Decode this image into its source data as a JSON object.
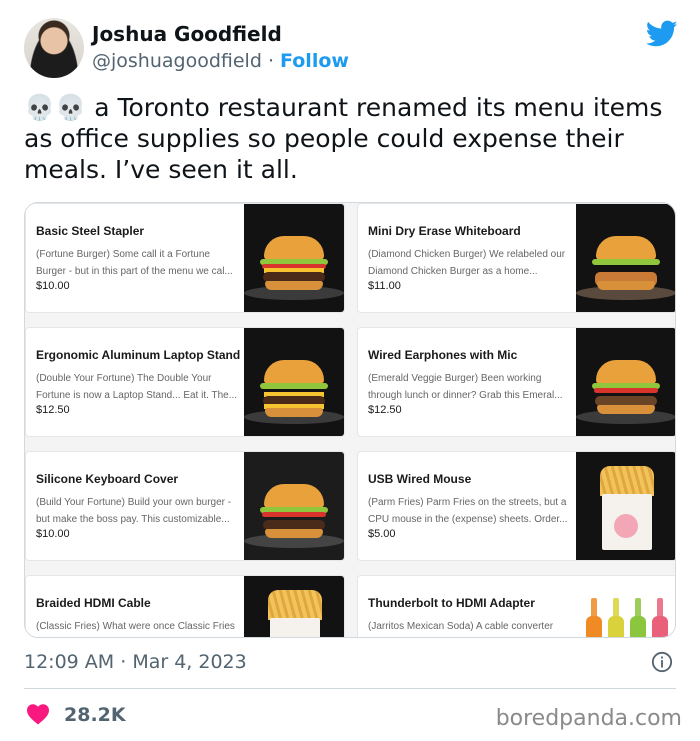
{
  "author": {
    "name": "Joshua Goodfield",
    "handle": "@joshuagoodfield",
    "separator": "·",
    "follow_label": "Follow"
  },
  "tweet": {
    "text": "💀💀 a Toronto restaurant renamed its menu items as office supplies so people could expense their meals. I’ve seen it all."
  },
  "menu": {
    "items": [
      {
        "title": "Basic Steel Stapler",
        "desc": "(Fortune Burger) Some call it a Fortune Burger - but in this part of the menu we cal...",
        "price": "$10.00",
        "image": "burger-photo"
      },
      {
        "title": "Mini Dry Erase Whiteboard",
        "desc": "(Diamond Chicken Burger) We relabeled our Diamond Chicken Burger as a home...",
        "price": "$11.00",
        "image": "chicken-burger-photo"
      },
      {
        "title": "Ergonomic Aluminum Laptop Stand",
        "desc": "(Double Your Fortune) The Double Your Fortune is now a Laptop Stand... Eat it. The...",
        "price": "$12.50",
        "image": "double-burger-photo"
      },
      {
        "title": "Wired Earphones with Mic",
        "desc": "(Emerald Veggie Burger) Been working through lunch or dinner? Grab this Emeral...",
        "price": "$12.50",
        "image": "veggie-burger-photo"
      },
      {
        "title": "Silicone Keyboard Cover",
        "desc": "(Build Your Fortune) Build your own burger - but make the boss pay. This customizable...",
        "price": "$10.00",
        "image": "custom-burger-photo"
      },
      {
        "title": "USB Wired Mouse",
        "desc": "(Parm Fries) Parm Fries on the streets, but a CPU mouse in the (expense) sheets. Order...",
        "price": "$5.00",
        "image": "parm-fries-photo"
      },
      {
        "title": "Braided HDMI Cable",
        "desc": "(Classic Fries) What were once Classic Fries",
        "price": "",
        "image": "classic-fries-photo"
      },
      {
        "title": "Thunderbolt to HDMI Adapter",
        "desc": "(Jarritos Mexican Soda) A cable converter",
        "price": "",
        "image": "soda-bottles-photo"
      }
    ]
  },
  "meta": {
    "time": "12:09 AM",
    "separator": "·",
    "date": "Mar 4, 2023"
  },
  "engagement": {
    "likes": "28.2K"
  },
  "watermark": "boredpanda.com",
  "colors": {
    "twitter_blue": "#1d9bf0",
    "heart_red": "#f91880",
    "muted_text": "#536471"
  }
}
